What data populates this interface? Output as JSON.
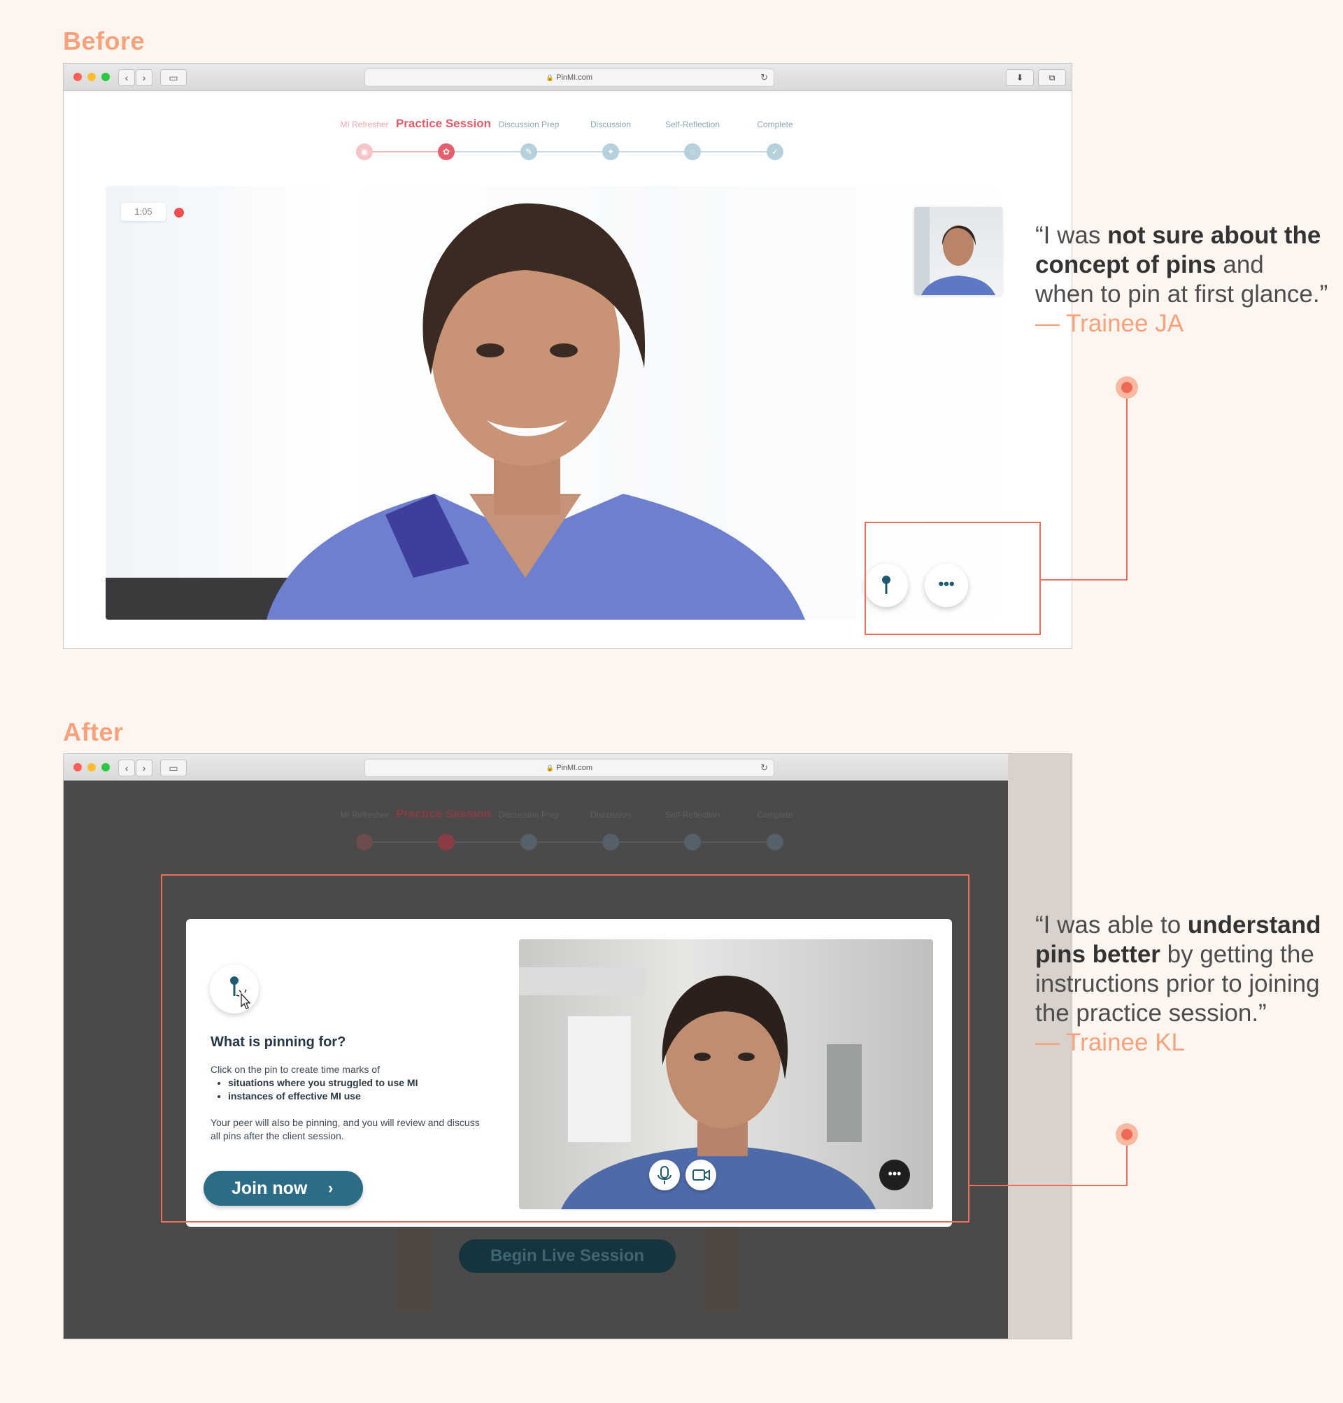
{
  "before": {
    "section_label": "Before",
    "browser": {
      "url": "PinMI.com"
    },
    "stepper": {
      "steps": [
        {
          "label": "MI Refresher",
          "state": "past"
        },
        {
          "label": "Practice Session",
          "state": "active"
        },
        {
          "label": "Discussion Prep",
          "state": "future"
        },
        {
          "label": "Discussion",
          "state": "future"
        },
        {
          "label": "Self-Reflection",
          "state": "future"
        },
        {
          "label": "Complete",
          "state": "future"
        }
      ]
    },
    "video": {
      "timer": "1:05",
      "recording": true
    },
    "controls": {
      "pin_icon": "pin-icon",
      "more_icon": "ellipsis-icon"
    },
    "quote": {
      "open": "“I was ",
      "bold1": "not sure about the concept of pins",
      "rest": " and when to pin at first glance.”",
      "attribution": "— Trainee JA"
    }
  },
  "after": {
    "section_label": "After",
    "browser": {
      "url": "PinMI.com"
    },
    "dialog": {
      "title": "What is pinning for?",
      "intro": "Click on the pin to create time marks of",
      "bullets": [
        "situations where you struggled to use MI",
        "instances of effective MI use"
      ],
      "peer_text": "Your peer will also be pinning, and you will review and discuss all pins after the client session.",
      "join_label": "Join now",
      "join_icon": "chevron-right-icon"
    },
    "background_button": "Begin Live Session",
    "quote": {
      "open": "“I was able to ",
      "bold1": "understand pins better",
      "rest": " by getting the instructions prior to joining the practice session.”",
      "attribution": "— Trainee KL"
    }
  },
  "colors": {
    "accent_peach": "#f7a27c",
    "highlight": "#ec6f5e",
    "active_step": "#e45f6f",
    "join_button": "#2c6c86"
  }
}
